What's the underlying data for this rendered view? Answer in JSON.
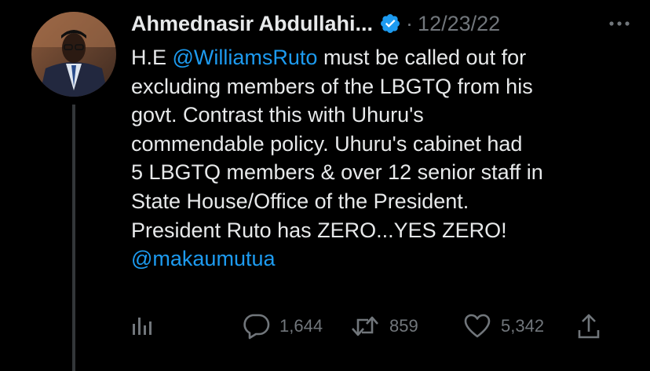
{
  "author": {
    "display_name": "Ahmednasir Abdullahi...",
    "verified_icon": "verified-badge",
    "separator": "·",
    "timestamp": "12/23/22"
  },
  "tweet": {
    "lines": [
      [
        {
          "text": "H.E ",
          "mention": false
        },
        {
          "text": "@WilliamsRuto",
          "mention": true
        },
        {
          "text": " must be called out for",
          "mention": false
        }
      ],
      [
        {
          "text": "excluding members of the LBGTQ from his",
          "mention": false
        }
      ],
      [
        {
          "text": "govt. Contrast this with Uhuru's",
          "mention": false
        }
      ],
      [
        {
          "text": "commendable policy. Uhuru's cabinet had",
          "mention": false
        }
      ],
      [
        {
          "text": "5 LBGTQ members & over 12 senior staff in",
          "mention": false
        }
      ],
      [
        {
          "text": "State House/Office of the President.",
          "mention": false
        }
      ],
      [
        {
          "text": "President Ruto has ZERO...YES ZERO!",
          "mention": false
        }
      ],
      [
        {
          "text": "@makaumutua",
          "mention": true
        }
      ]
    ]
  },
  "actions": {
    "analytics_icon": "analytics-icon",
    "reply_icon": "reply-icon",
    "replies": "1,644",
    "retweet_icon": "retweet-icon",
    "retweets": "859",
    "like_icon": "heart-icon",
    "likes": "5,342",
    "share_icon": "share-icon"
  },
  "colors": {
    "background": "#000000",
    "text": "#e7e9ea",
    "muted": "#71767b",
    "accent": "#1d9bf0"
  }
}
